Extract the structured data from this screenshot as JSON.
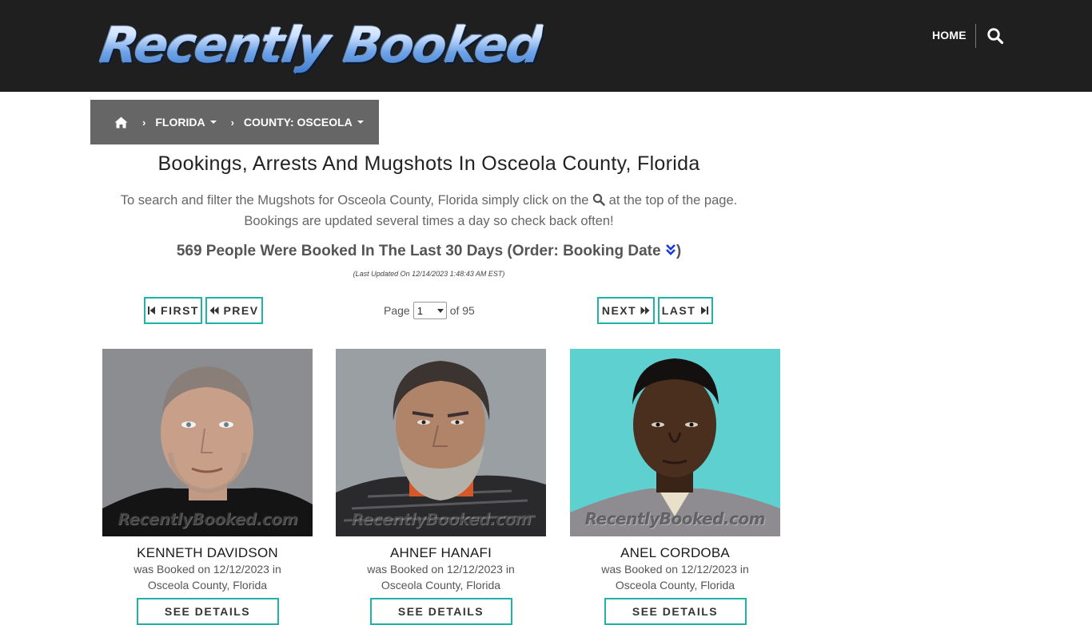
{
  "header": {
    "logo_text": "Recently Booked",
    "nav_home": "HOME",
    "search_icon": "search-icon"
  },
  "breadcrumb": {
    "home_icon": "home-icon",
    "items": [
      {
        "label": "FLORIDA"
      },
      {
        "label": "COUNTY: OSCEOLA"
      }
    ]
  },
  "main": {
    "title": "Bookings, Arrests And Mugshots In Osceola County, Florida",
    "desc_part1": "To search and filter the Mugshots for Osceola County, Florida simply click on the",
    "desc_part2": "at the top of the page.",
    "desc_line2": "Bookings are updated several times a day so check back often!",
    "count_text": "569 People Were Booked In The Last 30 Days (Order: Booking Date",
    "count_close": ")",
    "updated": "(Last Updated On 12/14/2023 1:48:43 AM EST)"
  },
  "pagination": {
    "first": "FIRST",
    "prev": "PREV",
    "page_label": "Page",
    "current_page": "1",
    "of_label": "of 95",
    "next": "NEXT",
    "last": "LAST"
  },
  "watermark": "RecentlyBooked.com",
  "people": [
    {
      "name": "KENNETH DAVIDSON",
      "line1": "was Booked on 12/12/2023 in",
      "line2": "Osceola County, Florida",
      "button": "SEE DETAILS"
    },
    {
      "name": "AHNEF HANAFI",
      "line1": "was Booked on 12/12/2023 in",
      "line2": "Osceola County, Florida",
      "button": "SEE DETAILS"
    },
    {
      "name": "ANEL CORDOBA",
      "line1": "was Booked on 12/12/2023 in",
      "line2": "Osceola County, Florida",
      "button": "SEE DETAILS"
    }
  ],
  "colors": {
    "header_bg": "#1f1f1f",
    "breadcrumb_bg": "#666666",
    "button_border": "#1fb3a8",
    "order_icon": "#1a3bd6"
  }
}
